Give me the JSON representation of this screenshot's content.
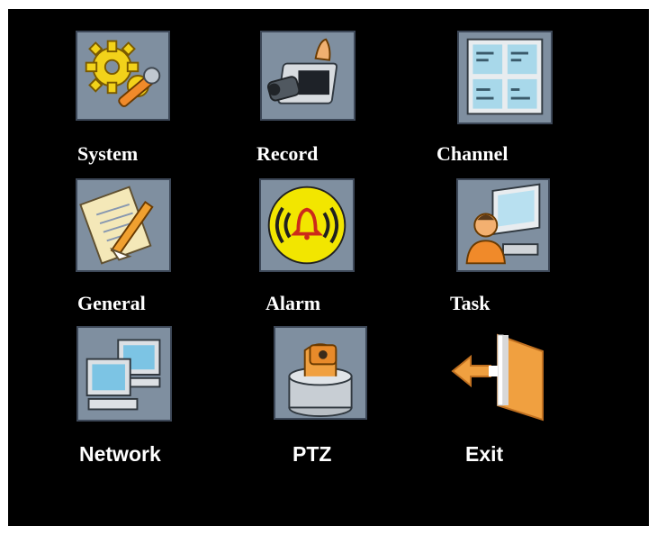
{
  "menu": {
    "items": [
      {
        "id": "system",
        "label": "System",
        "icon": "gear-wrench-icon"
      },
      {
        "id": "record",
        "label": "Record",
        "icon": "camera-recorder-icon"
      },
      {
        "id": "channel",
        "label": "Channel",
        "icon": "channel-grid-icon"
      },
      {
        "id": "general",
        "label": "General",
        "icon": "notepad-pencil-icon"
      },
      {
        "id": "alarm",
        "label": "Alarm",
        "icon": "alarm-bell-icon"
      },
      {
        "id": "task",
        "label": "Task",
        "icon": "user-monitor-icon"
      },
      {
        "id": "network",
        "label": "Network",
        "icon": "network-computers-icon"
      },
      {
        "id": "ptz",
        "label": "PTZ",
        "icon": "ptz-camera-icon"
      },
      {
        "id": "exit",
        "label": "Exit",
        "icon": "exit-door-icon"
      }
    ]
  },
  "colors": {
    "background": "#000000",
    "label": "#ffffff",
    "tile_bg": "#7f8fa0",
    "accent_orange": "#f0a040",
    "accent_yellow": "#f2e600"
  }
}
